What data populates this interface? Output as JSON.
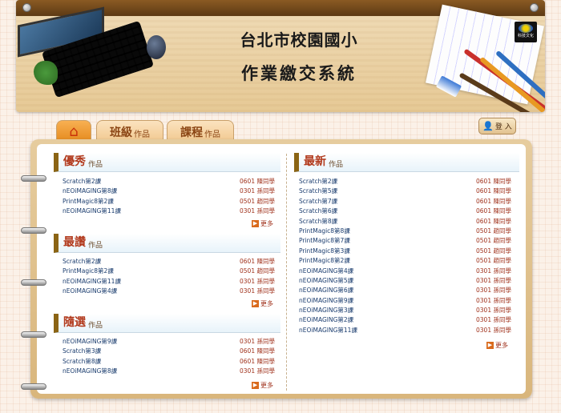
{
  "header": {
    "title": "台北市校園國小",
    "subtitle": "作業繳交系統",
    "logo_text": "科技文化"
  },
  "tabs": [
    {
      "name": "home",
      "icon": "home-icon"
    },
    {
      "big": "班級",
      "small": "作品"
    },
    {
      "big": "課程",
      "small": "作品"
    }
  ],
  "login": {
    "label": "登 入",
    "icon": "user-icon"
  },
  "sections": {
    "excellent": {
      "big": "優秀",
      "small": "作品",
      "items": [
        {
          "work": "Scratch第2課",
          "who": "0601 陳同學"
        },
        {
          "work": "nEOiMAGING第8課",
          "who": "0301 孫同學"
        },
        {
          "work": "PrintMagic8第2課",
          "who": "0501 趙同學"
        },
        {
          "work": "nEOiMAGING第11課",
          "who": "0301 孫同學"
        }
      ],
      "more": "更多"
    },
    "popular": {
      "big": "最讚",
      "small": "作品",
      "items": [
        {
          "work": "Scratch第2課",
          "who": "0601 陳同學"
        },
        {
          "work": "PrintMagic8第2課",
          "who": "0501 趙同學"
        },
        {
          "work": "nEOiMAGING第11課",
          "who": "0301 孫同學"
        },
        {
          "work": "nEOiMAGING第4課",
          "who": "0301 孫同學"
        }
      ],
      "more": "更多"
    },
    "random": {
      "big": "隨選",
      "small": "作品",
      "items": [
        {
          "work": "nEOiMAGING第9課",
          "who": "0301 孫同學"
        },
        {
          "work": "Scratch第3課",
          "who": "0601 陳同學"
        },
        {
          "work": "Scratch第8課",
          "who": "0601 陳同學"
        },
        {
          "work": "nEOiMAGING第8課",
          "who": "0301 孫同學"
        }
      ],
      "more": "更多"
    },
    "latest": {
      "big": "最新",
      "small": "作品",
      "items": [
        {
          "work": "Scratch第2課",
          "who": "0601 陳同學"
        },
        {
          "work": "Scratch第5課",
          "who": "0601 陳同學"
        },
        {
          "work": "Scratch第7課",
          "who": "0601 陳同學"
        },
        {
          "work": "Scratch第6課",
          "who": "0601 陳同學"
        },
        {
          "work": "Scratch第8課",
          "who": "0601 陳同學"
        },
        {
          "work": "PrintMagic8第8課",
          "who": "0501 趙同學"
        },
        {
          "work": "PrintMagic8第7課",
          "who": "0501 趙同學"
        },
        {
          "work": "PrintMagic8第3課",
          "who": "0501 趙同學"
        },
        {
          "work": "PrintMagic8第2課",
          "who": "0501 趙同學"
        },
        {
          "work": "nEOiMAGING第4課",
          "who": "0301 孫同學"
        },
        {
          "work": "nEOiMAGING第5課",
          "who": "0301 孫同學"
        },
        {
          "work": "nEOiMAGING第6課",
          "who": "0301 孫同學"
        },
        {
          "work": "nEOiMAGING第9課",
          "who": "0301 孫同學"
        },
        {
          "work": "nEOiMAGING第3課",
          "who": "0301 孫同學"
        },
        {
          "work": "nEOiMAGING第2課",
          "who": "0301 孫同學"
        },
        {
          "work": "nEOiMAGING第11課",
          "who": "0301 孫同學"
        }
      ],
      "more": "更多"
    }
  }
}
